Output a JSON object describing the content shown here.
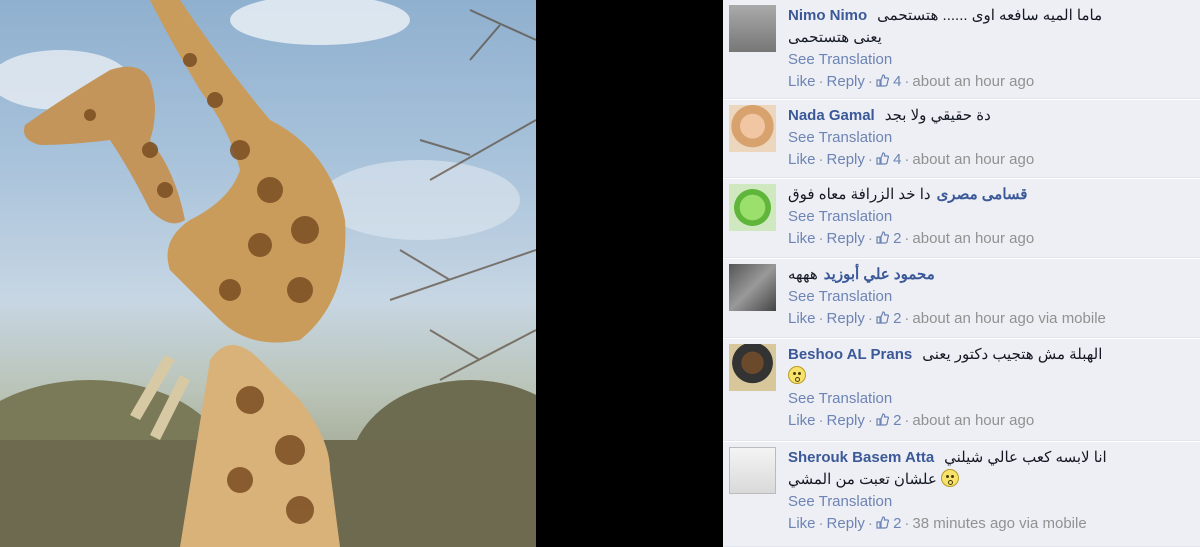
{
  "photo": {
    "subject": "giraffe-photo"
  },
  "comments": [
    {
      "name": "Nimo Nimo",
      "text": "ماما الميه سافعه اوى ...... هتستحمى",
      "text2": "يعنى هتستحمى",
      "see_translation": "See Translation",
      "like": "Like",
      "reply": "Reply",
      "likes": "4",
      "time": "about an hour ago",
      "avatar": "avatar-gray"
    },
    {
      "name": "Nada Gamal",
      "text": "دة حقيقي ولا بجد",
      "see_translation": "See Translation",
      "like": "Like",
      "reply": "Reply",
      "likes": "4",
      "time": "about an hour ago",
      "avatar": "avatar-child"
    },
    {
      "name": "قسامى مصرى",
      "text": "دا خد الزرافة معاه فوق",
      "see_translation": "See Translation",
      "like": "Like",
      "reply": "Reply",
      "likes": "2",
      "time": "about an hour ago",
      "avatar": "avatar-green"
    },
    {
      "name": "محمود علي أبوزيد",
      "text": "هههه",
      "see_translation": "See Translation",
      "like": "Like",
      "reply": "Reply",
      "likes": "2",
      "time": "about an hour ago via mobile",
      "avatar": "avatar-dark"
    },
    {
      "name": "Beshoo AL Prans",
      "text": "الهبلة مش هتجيب دكتور يعنى",
      "see_translation": "See Translation",
      "like": "Like",
      "reply": "Reply",
      "likes": "2",
      "time": "about an hour ago",
      "avatar": "avatar-man"
    },
    {
      "name": "Sherouk Basem Atta",
      "text": "انا لابسه كعب عالي شيلني",
      "text2": "علشان تعبت من المشي",
      "see_translation": "See Translation",
      "like": "Like",
      "reply": "Reply",
      "likes": "2",
      "time": "38 minutes ago via mobile",
      "avatar": "avatar-sketch"
    }
  ],
  "colors": {
    "link": "#3b5998",
    "panel": "#edeff4",
    "secondary": "#6d84b4"
  }
}
